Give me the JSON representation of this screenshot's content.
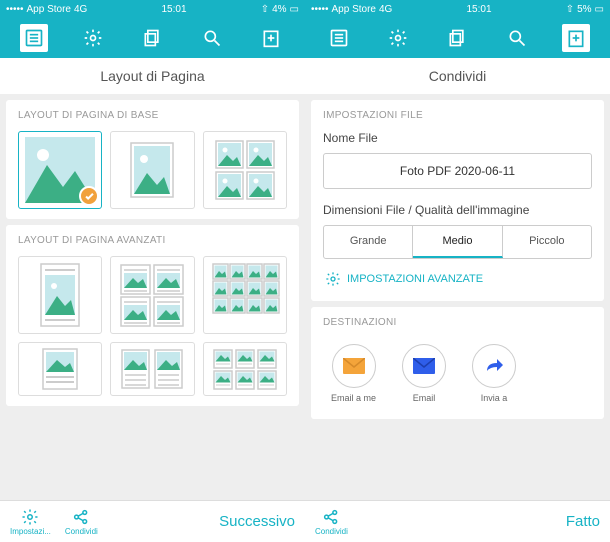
{
  "status": {
    "back": "App Store",
    "net": "4G",
    "time": "15:01",
    "batt_l": "4%",
    "batt_r": "5%",
    "sig": "●●●●○"
  },
  "left": {
    "title": "Layout di Pagina",
    "sec1": "LAYOUT DI PAGINA DI BASE",
    "sec2": "LAYOUT DI PAGINA AVANZATI",
    "bottom": {
      "settings": "Impostazi...",
      "share": "Condividi",
      "action": "Successivo"
    }
  },
  "right": {
    "title": "Condividi",
    "sec1": "IMPOSTAZIONI FILE",
    "filelabel": "Nome File",
    "filename": "Foto PDF 2020-06-11",
    "sizelabel": "Dimensioni File / Qualità dell'immagine",
    "seg": {
      "large": "Grande",
      "medium": "Medio",
      "small": "Piccolo"
    },
    "advanced": "IMPOSTAZIONI AVANZATE",
    "sec2": "DESTINAZIONI",
    "dest": {
      "emailme": "Email a me",
      "email": "Email",
      "send": "Invia a"
    },
    "bottom": {
      "share": "Condividi",
      "action": "Fatto"
    }
  }
}
